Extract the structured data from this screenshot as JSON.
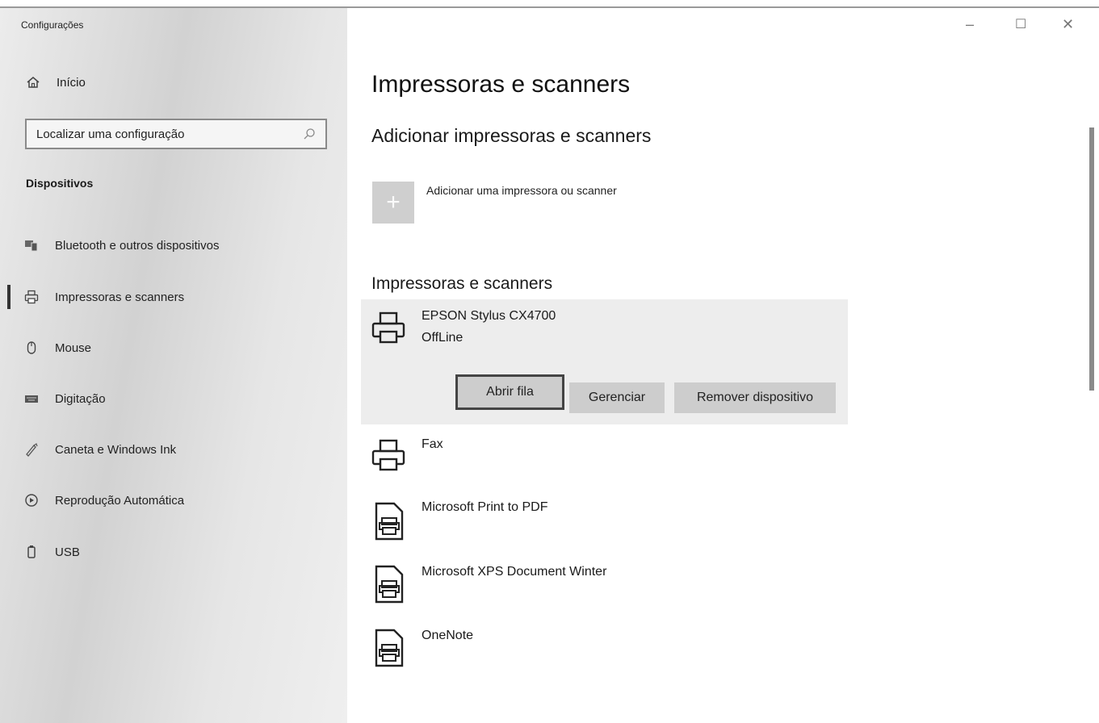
{
  "window": {
    "title": "Configurações",
    "controls": {
      "minimize": "–",
      "maximize": "☐",
      "close": "✕"
    }
  },
  "sidebar": {
    "home_label": "Início",
    "search": {
      "placeholder": "Localizar uma configuração"
    },
    "section_label": "Dispositivos",
    "items": [
      {
        "label": "Bluetooth e outros dispositivos",
        "icon": "bluetooth-devices-icon"
      },
      {
        "label": "Impressoras e scanners",
        "icon": "printer-icon",
        "active": true
      },
      {
        "label": "Mouse",
        "icon": "mouse-icon"
      },
      {
        "label": "Digitação",
        "icon": "keyboard-icon"
      },
      {
        "label": "Caneta e Windows Ink",
        "icon": "pen-icon"
      },
      {
        "label": "Reprodução Automática",
        "icon": "autoplay-icon"
      },
      {
        "label": "USB",
        "icon": "usb-icon"
      }
    ]
  },
  "main": {
    "title": "Impressoras e scanners",
    "add_section": {
      "title": "Adicionar impressoras e scanners",
      "add_label": "Adicionar uma impressora ou scanner"
    },
    "list_title": "Impressoras e scanners",
    "devices": [
      {
        "name": "EPSON Stylus CX4700",
        "status": "OffLine",
        "icon": "printer-icon",
        "selected": true,
        "actions": [
          "Abrir fila",
          "Gerenciar",
          "Remover dispositivo"
        ]
      },
      {
        "name": "Fax",
        "icon": "printer-icon"
      },
      {
        "name": "Microsoft Print to PDF",
        "icon": "document-printer-icon"
      },
      {
        "name": "Microsoft XPS Document Winter",
        "icon": "document-printer-icon"
      },
      {
        "name": "OneNote",
        "icon": "document-printer-icon"
      }
    ]
  },
  "colors": {
    "sidebar_bg": "#d2d2d2",
    "selected_card_bg": "#ededed",
    "button_bg": "#cdcdcd",
    "add_tile_bg": "#cfcfcf"
  }
}
